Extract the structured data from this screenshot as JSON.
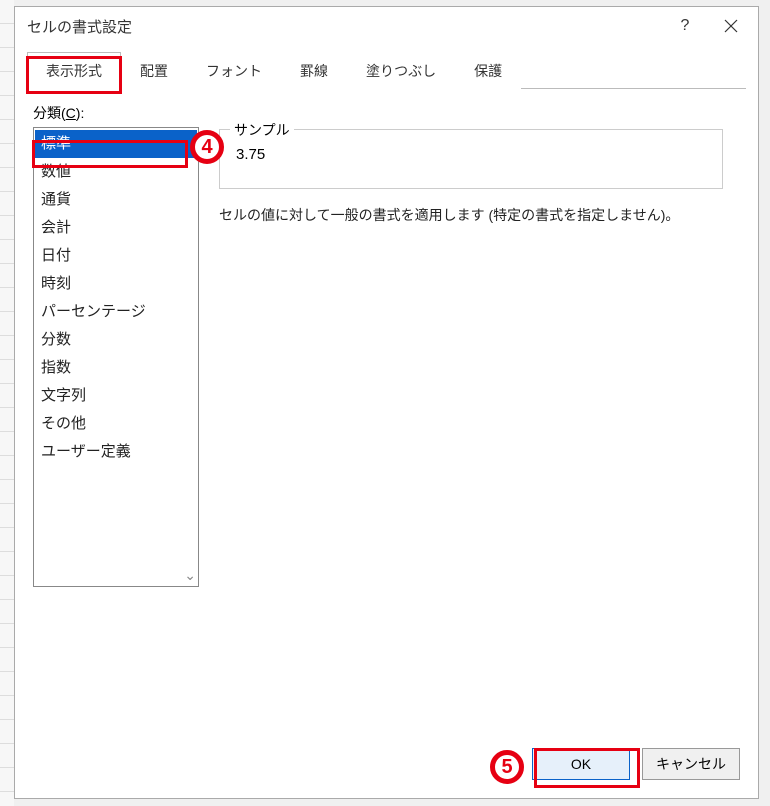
{
  "dialog": {
    "title": "セルの書式設定"
  },
  "tabs": [
    {
      "label": "表示形式",
      "active": true
    },
    {
      "label": "配置",
      "active": false
    },
    {
      "label": "フォント",
      "active": false
    },
    {
      "label": "罫線",
      "active": false
    },
    {
      "label": "塗りつぶし",
      "active": false
    },
    {
      "label": "保護",
      "active": false
    }
  ],
  "category": {
    "label_prefix": "分類(",
    "label_key": "C",
    "label_suffix": "):",
    "items": [
      "標準",
      "数値",
      "通貨",
      "会計",
      "日付",
      "時刻",
      "パーセンテージ",
      "分数",
      "指数",
      "文字列",
      "その他",
      "ユーザー定義"
    ],
    "selected_index": 0
  },
  "sample": {
    "label": "サンプル",
    "value": "3.75",
    "description": "セルの値に対して一般の書式を適用します (特定の書式を指定しません)。"
  },
  "buttons": {
    "ok": "OK",
    "cancel": "キャンセル"
  },
  "annotations": {
    "step4": "4",
    "step5": "5"
  }
}
